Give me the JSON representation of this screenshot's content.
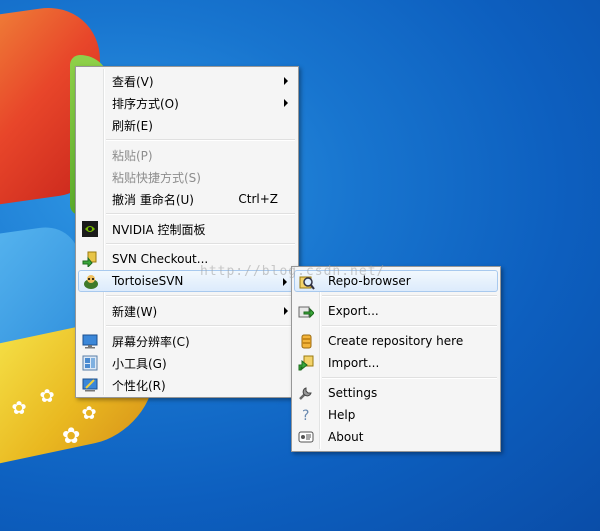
{
  "colors": {
    "menu_bg": "#f5f5f5",
    "menu_border": "#979797",
    "highlight": "#dcebfc",
    "disabled_text": "#8d8d8d",
    "desktop_blue": "#1875cf"
  },
  "main_menu": {
    "items": [
      {
        "label": "查看(V)",
        "submenu": true
      },
      {
        "label": "排序方式(O)",
        "submenu": true
      },
      {
        "label": "刷新(E)"
      },
      {
        "label": "粘贴(P)",
        "disabled": true
      },
      {
        "label": "粘贴快捷方式(S)",
        "disabled": true
      },
      {
        "label": "撤消 重命名(U)",
        "shortcut": "Ctrl+Z"
      },
      {
        "label": "NVIDIA 控制面板",
        "icon": "nvidia-icon"
      },
      {
        "label": "SVN Checkout...",
        "icon": "svn-checkout-icon"
      },
      {
        "label": "TortoiseSVN",
        "icon": "tortoisesvn-icon",
        "submenu": true,
        "hover": true
      },
      {
        "label": "新建(W)",
        "submenu": true
      },
      {
        "label": "屏幕分辨率(C)",
        "icon": "screen-resolution-icon"
      },
      {
        "label": "小工具(G)",
        "icon": "gadgets-icon"
      },
      {
        "label": "个性化(R)",
        "icon": "personalize-icon"
      }
    ]
  },
  "sub_menu": {
    "items": [
      {
        "label": "Repo-browser",
        "icon": "repo-browser-icon",
        "hover": true
      },
      {
        "label": "Export...",
        "icon": "export-icon"
      },
      {
        "label": "Create repository here",
        "icon": "create-repo-icon"
      },
      {
        "label": "Import...",
        "icon": "import-icon"
      },
      {
        "label": "Settings",
        "icon": "settings-icon"
      },
      {
        "label": "Help",
        "icon": "help-icon"
      },
      {
        "label": "About",
        "icon": "about-icon"
      }
    ]
  },
  "watermark": "http://blog.csdn.net/"
}
